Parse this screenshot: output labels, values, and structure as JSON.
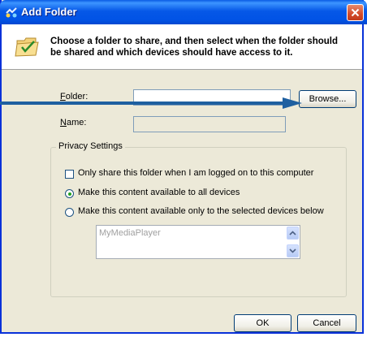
{
  "window": {
    "title": "Add Folder"
  },
  "header": {
    "description": "Choose a folder to share, and then select when the folder should be shared and which devices should have access to it."
  },
  "form": {
    "folder_label_accel": "F",
    "folder_label_rest": "older:",
    "folder_value": "",
    "name_label_accel": "N",
    "name_label_rest": "ame:",
    "name_value": "",
    "browse_label": "Browse..."
  },
  "privacy": {
    "group_label": "Privacy Settings",
    "only_when_logged_on": "Only share this folder when I am logged on to this computer",
    "all_devices": "Make this content available to all devices",
    "selected_devices": "Make this content available only to the selected devices below",
    "selected_option": "all_devices",
    "only_when_logged_on_checked": false,
    "devices": [
      "MyMediaPlayer"
    ]
  },
  "footer": {
    "ok_label": "OK",
    "cancel_label": "Cancel"
  },
  "colors": {
    "titlebar": "#0153e6",
    "callout_arrow": "#1e5fa0",
    "face": "#ece9d8"
  }
}
